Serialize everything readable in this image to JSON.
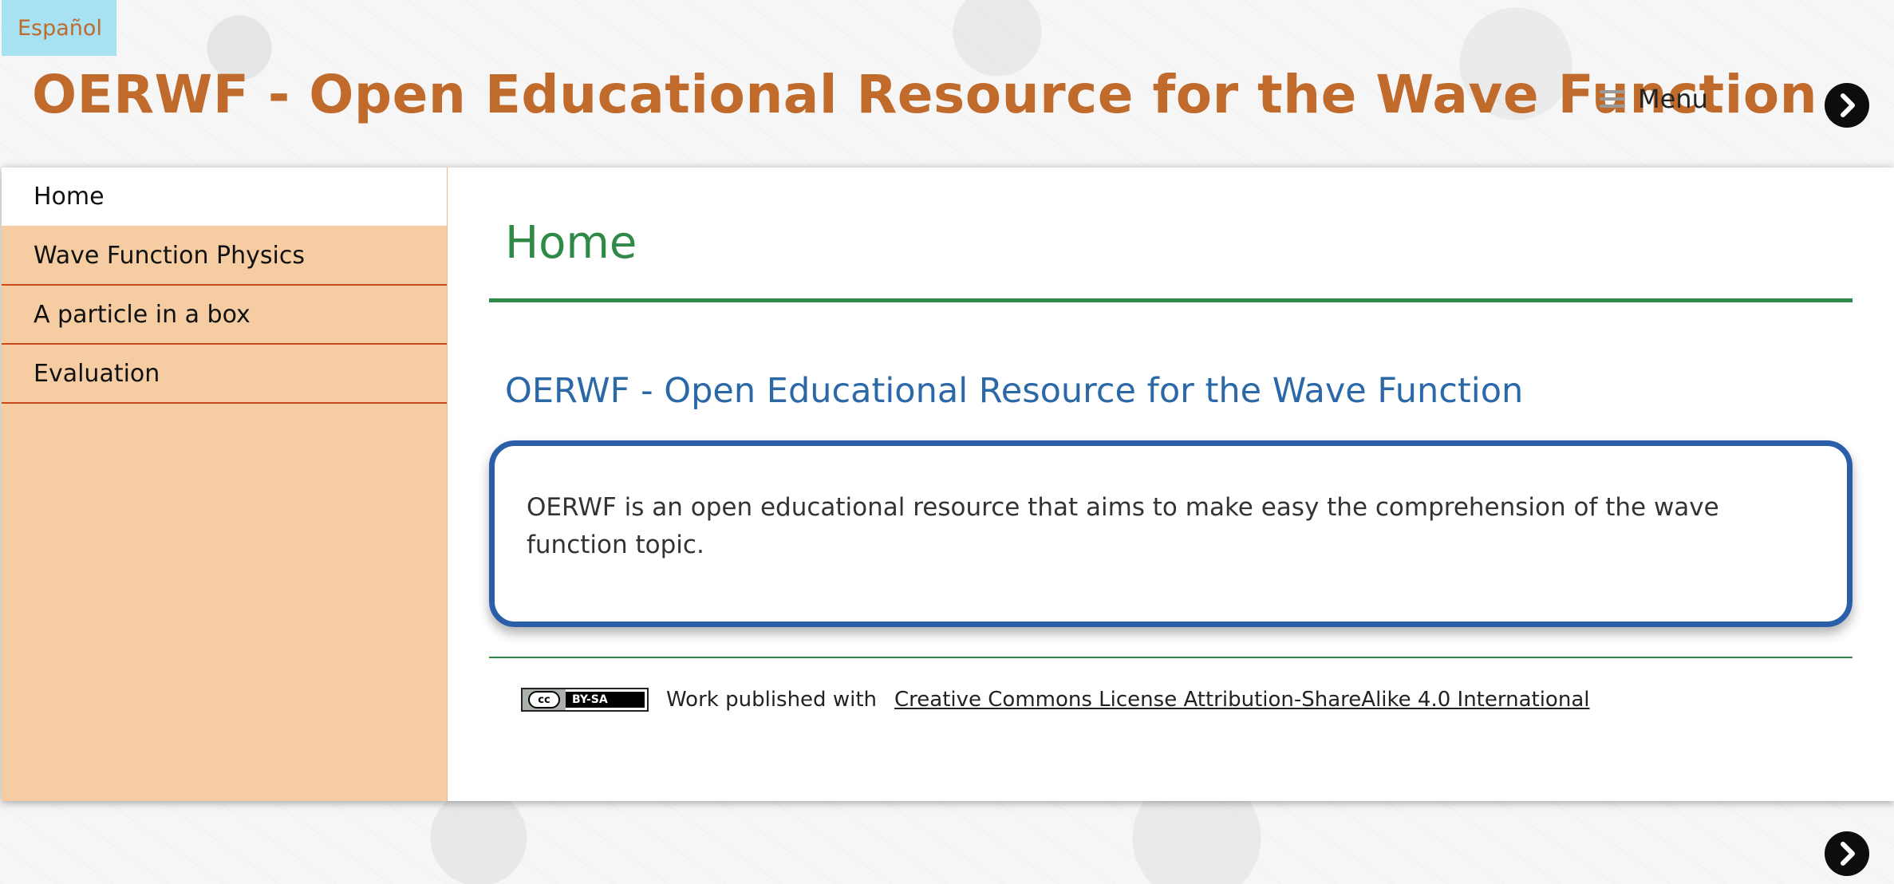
{
  "header": {
    "language_link": "Español",
    "site_title": "OERWF - Open Educational Resource for the Wave Function",
    "menu_label": "Menu"
  },
  "sidebar": {
    "items": [
      {
        "label": "Home",
        "active": true
      },
      {
        "label": "Wave Function Physics",
        "active": false
      },
      {
        "label": "A particle in a box",
        "active": false
      },
      {
        "label": "Evaluation",
        "active": false
      }
    ]
  },
  "main": {
    "page_title": "Home",
    "section_heading": "OERWF - Open Educational Resource for the Wave Function",
    "info_text": "OERWF is an open educational resource that aims to make easy the comprehension of the wave function topic."
  },
  "footer": {
    "license_badge_left": "cc",
    "license_badge_right": "BY-SA",
    "license_prefix": "Work published with",
    "license_link": "Creative Commons License Attribution-ShareAlike 4.0 International"
  },
  "colors": {
    "title_orange": "#c06a2c",
    "heading_green": "#2f8a47",
    "heading_blue": "#2a68a8",
    "sidebar_bg": "#f6cda2",
    "lang_bg": "#a6e2f2",
    "box_border": "#2b5ea8"
  },
  "icons": {
    "menu": "hamburger-icon",
    "next": "chevron-right-icon"
  }
}
